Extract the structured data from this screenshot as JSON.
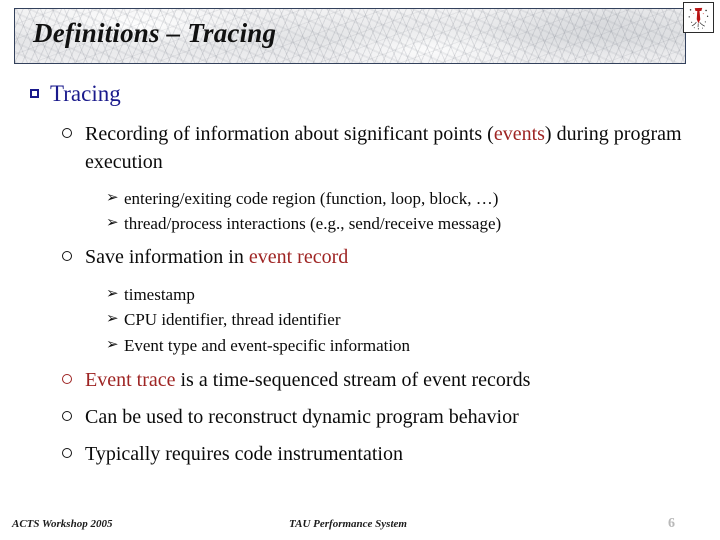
{
  "slide": {
    "title": "Definitions – Tracing",
    "logo_name": "tau-red-splatter-logo",
    "colors": {
      "title_text": "#111111",
      "level1_blue": "#1a1a8c",
      "highlight_red": "#9e2423",
      "body_black": "#0b0b0b",
      "title_border": "#33415c",
      "page_number_gray": "#b9b9b9"
    },
    "body": {
      "heading": "Tracing",
      "items": [
        {
          "level": 2,
          "bullet": "hollow-circle",
          "bullet_color": "black",
          "segments": [
            {
              "text": "Recording of information about significant points (",
              "highlight": false
            },
            {
              "text": "events",
              "highlight": true
            },
            {
              "text": ") during program execution",
              "highlight": false
            }
          ]
        },
        {
          "level": 3,
          "bullet": "arrow",
          "segments": [
            {
              "text": "entering/exiting code region (function, loop, block, …)",
              "highlight": false
            }
          ]
        },
        {
          "level": 3,
          "bullet": "arrow",
          "segments": [
            {
              "text": "thread/process interactions (e.g., send/receive message)",
              "highlight": false
            }
          ]
        },
        {
          "level": 2,
          "bullet": "hollow-circle",
          "bullet_color": "black",
          "segments": [
            {
              "text": "Save information in ",
              "highlight": false
            },
            {
              "text": "event record",
              "highlight": true
            }
          ]
        },
        {
          "level": 3,
          "bullet": "arrow",
          "segments": [
            {
              "text": "timestamp",
              "highlight": false
            }
          ]
        },
        {
          "level": 3,
          "bullet": "arrow",
          "segments": [
            {
              "text": "CPU identifier, thread identifier",
              "highlight": false
            }
          ]
        },
        {
          "level": 3,
          "bullet": "arrow",
          "segments": [
            {
              "text": "Event type and event-specific information",
              "highlight": false
            }
          ]
        },
        {
          "level": 2,
          "bullet": "hollow-circle",
          "bullet_color": "red",
          "segments": [
            {
              "text": "Event trace",
              "highlight": true
            },
            {
              "text": " is a time-sequenced stream of event records",
              "highlight": false
            }
          ]
        },
        {
          "level": 2,
          "bullet": "hollow-circle",
          "bullet_color": "black",
          "segments": [
            {
              "text": "Can be used to reconstruct dynamic program behavior",
              "highlight": false
            }
          ]
        },
        {
          "level": 2,
          "bullet": "hollow-circle",
          "bullet_color": "black",
          "segments": [
            {
              "text": "Typically requires code instrumentation",
              "highlight": false
            }
          ]
        }
      ],
      "arrow_glyph": "➢"
    },
    "footer": {
      "left": "ACTS Workshop 2005",
      "center": "TAU Performance System",
      "page": "6"
    }
  }
}
